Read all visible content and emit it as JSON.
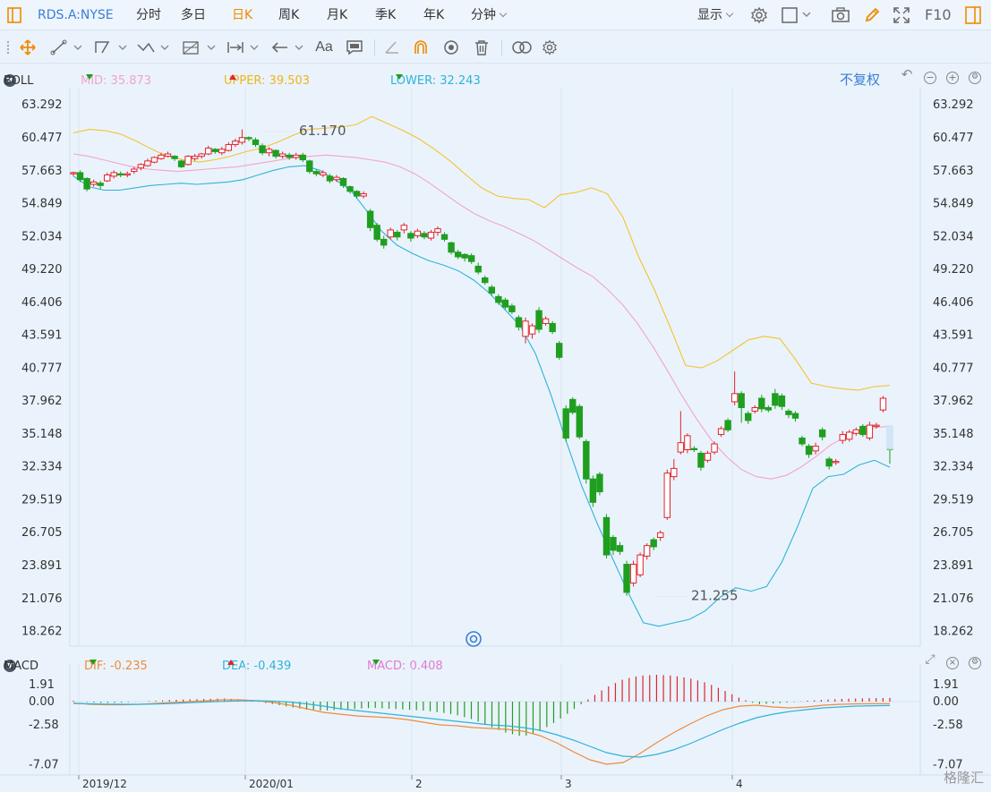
{
  "topbar": {
    "symbol": "RDS.A:NYSE",
    "periods": [
      "分时",
      "多日",
      "日K",
      "周K",
      "月K",
      "季K",
      "年K",
      "分钟"
    ],
    "active_period": "日K",
    "display_label": "显示",
    "f10_label": "F10"
  },
  "boll_legend": {
    "name": "BOLL",
    "mid": "MID: 35.873",
    "upper": "UPPER: 39.503",
    "lower": "LOWER: 32.243",
    "adjust_label": "不复权"
  },
  "macd_legend": {
    "name": "MACD",
    "dif": "DIF: -0.235",
    "dea": "DEA: -0.439",
    "macd": "MACD: 0.408"
  },
  "colors": {
    "up": "#e0232b",
    "down": "#1f9e1f",
    "mid": "#f4a3c8",
    "upper": "#f5c22f",
    "lower": "#2fb3d8",
    "dif": "#f08a3c",
    "dea": "#2fb3d8",
    "active": "#f08a00",
    "link": "#3b7fd4"
  },
  "watermark": "格隆汇",
  "chart_data": [
    {
      "type": "candlestick",
      "title": "",
      "y_ticks": [
        "63.292",
        "60.477",
        "57.663",
        "54.849",
        "52.034",
        "49.220",
        "46.406",
        "43.591",
        "40.777",
        "37.962",
        "35.148",
        "32.334",
        "29.519",
        "26.705",
        "23.891",
        "21.076",
        "18.262"
      ],
      "ylim": [
        17.0,
        64.0
      ],
      "x_ticks": [
        "2019/12",
        "2020/01",
        "2",
        "3",
        "4"
      ],
      "annotations": [
        "61.170",
        "21.255"
      ],
      "candles": [
        [
          57.4,
          57.5,
          57.2,
          57.6
        ],
        [
          57.5,
          56.9,
          56.7,
          57.7
        ],
        [
          57.0,
          56.1,
          55.9,
          57.1
        ],
        [
          56.5,
          56.7,
          56.3,
          56.9
        ],
        [
          56.6,
          56.4,
          56.1,
          56.8
        ],
        [
          56.8,
          57.3,
          56.7,
          57.5
        ],
        [
          57.2,
          57.5,
          57.0,
          57.7
        ],
        [
          57.4,
          57.3,
          57.1,
          57.6
        ],
        [
          57.3,
          57.4,
          57.1,
          57.6
        ],
        [
          57.6,
          57.8,
          57.4,
          58.0
        ],
        [
          57.9,
          58.2,
          57.7,
          58.3
        ],
        [
          58.1,
          58.5,
          58.0,
          58.7
        ],
        [
          58.4,
          58.8,
          58.3,
          58.9
        ],
        [
          58.7,
          59.0,
          58.6,
          59.2
        ],
        [
          58.9,
          59.1,
          58.8,
          59.3
        ],
        [
          58.9,
          58.7,
          58.5,
          59.0
        ],
        [
          58.5,
          58.0,
          57.9,
          58.6
        ],
        [
          58.2,
          58.9,
          58.1,
          59.0
        ],
        [
          58.7,
          58.9,
          58.5,
          59.1
        ],
        [
          58.9,
          59.1,
          58.7,
          59.2
        ],
        [
          59.1,
          59.6,
          59.0,
          59.8
        ],
        [
          59.5,
          59.3,
          59.1,
          59.6
        ],
        [
          59.2,
          59.5,
          59.0,
          59.7
        ],
        [
          59.4,
          59.9,
          59.3,
          60.1
        ],
        [
          59.9,
          60.2,
          59.7,
          60.4
        ],
        [
          60.1,
          60.5,
          59.9,
          61.2
        ],
        [
          60.5,
          60.4,
          60.2,
          60.6
        ],
        [
          60.3,
          59.9,
          59.7,
          60.5
        ],
        [
          59.8,
          59.2,
          59.0,
          60.0
        ],
        [
          59.2,
          59.5,
          58.9,
          59.7
        ],
        [
          59.4,
          58.9,
          58.7,
          59.5
        ],
        [
          58.9,
          59.1,
          58.7,
          59.3
        ],
        [
          59.0,
          58.8,
          58.6,
          59.2
        ],
        [
          58.8,
          59.0,
          58.6,
          59.2
        ],
        [
          59.0,
          58.6,
          58.4,
          59.2
        ],
        [
          58.5,
          57.6,
          57.4,
          58.6
        ],
        [
          57.6,
          57.4,
          57.2,
          57.8
        ],
        [
          57.3,
          57.5,
          57.1,
          57.7
        ],
        [
          57.2,
          56.8,
          56.6,
          57.4
        ],
        [
          56.9,
          57.1,
          56.7,
          57.3
        ],
        [
          57.0,
          56.4,
          56.2,
          57.1
        ],
        [
          56.3,
          55.9,
          55.7,
          56.4
        ],
        [
          55.9,
          55.5,
          55.3,
          56.0
        ],
        [
          55.5,
          55.7,
          55.3,
          55.9
        ],
        [
          54.2,
          52.8,
          52.5,
          54.4
        ],
        [
          53.0,
          51.8,
          51.6,
          53.2
        ],
        [
          51.8,
          51.3,
          51.0,
          52.1
        ],
        [
          52.0,
          52.6,
          51.8,
          52.8
        ],
        [
          52.4,
          52.0,
          51.7,
          52.6
        ],
        [
          52.6,
          53.0,
          52.3,
          53.2
        ],
        [
          52.3,
          51.9,
          51.6,
          52.5
        ],
        [
          52.1,
          52.5,
          51.9,
          52.7
        ],
        [
          52.3,
          52.0,
          51.8,
          52.5
        ],
        [
          51.9,
          52.4,
          51.7,
          52.6
        ],
        [
          52.4,
          52.7,
          52.1,
          52.9
        ],
        [
          52.2,
          51.8,
          51.6,
          52.4
        ],
        [
          51.5,
          50.7,
          50.5,
          51.6
        ],
        [
          50.7,
          50.3,
          50.1,
          50.9
        ],
        [
          50.5,
          50.2,
          49.9,
          50.6
        ],
        [
          50.4,
          49.9,
          49.7,
          50.6
        ],
        [
          49.5,
          49.0,
          48.8,
          49.8
        ],
        [
          48.5,
          48.1,
          47.9,
          48.7
        ],
        [
          47.7,
          47.2,
          47.0,
          47.9
        ],
        [
          46.9,
          46.4,
          46.2,
          47.1
        ],
        [
          46.6,
          46.0,
          45.8,
          46.8
        ],
        [
          46.1,
          45.6,
          45.4,
          46.3
        ],
        [
          45.1,
          44.3,
          44.0,
          45.3
        ],
        [
          43.5,
          44.8,
          42.9,
          45.1
        ],
        [
          43.7,
          44.4,
          43.3,
          44.6
        ],
        [
          45.7,
          44.1,
          43.8,
          46.0
        ],
        [
          44.6,
          45.0,
          44.4,
          45.2
        ],
        [
          44.6,
          43.9,
          43.7,
          44.8
        ],
        [
          42.9,
          41.7,
          41.5,
          43.1
        ],
        [
          37.3,
          34.8,
          34.5,
          37.6
        ],
        [
          38.1,
          37.0,
          36.8,
          38.3
        ],
        [
          37.5,
          34.9,
          34.7,
          37.7
        ],
        [
          34.5,
          31.3,
          30.9,
          34.7
        ],
        [
          31.3,
          29.3,
          28.9,
          31.6
        ],
        [
          31.7,
          30.2,
          29.9,
          31.9
        ],
        [
          28.0,
          24.8,
          24.5,
          28.3
        ],
        [
          26.3,
          25.2,
          24.8,
          26.5
        ],
        [
          25.6,
          25.1,
          24.8,
          25.9
        ],
        [
          24.0,
          21.6,
          21.3,
          24.3
        ],
        [
          22.4,
          24.0,
          22.1,
          24.3
        ],
        [
          23.1,
          24.8,
          22.9,
          25.0
        ],
        [
          24.7,
          25.6,
          24.4,
          25.8
        ],
        [
          26.1,
          25.5,
          25.2,
          26.3
        ],
        [
          26.3,
          26.7,
          26.0,
          26.9
        ],
        [
          28.0,
          31.8,
          27.8,
          32.1
        ],
        [
          31.5,
          32.2,
          31.2,
          33.0
        ],
        [
          33.6,
          34.4,
          33.4,
          37.1
        ],
        [
          33.8,
          35.0,
          33.5,
          35.2
        ],
        [
          33.9,
          33.8,
          33.6,
          34.1
        ],
        [
          33.5,
          32.3,
          32.0,
          33.7
        ],
        [
          32.9,
          33.5,
          32.7,
          33.7
        ],
        [
          33.6,
          34.3,
          33.4,
          34.5
        ],
        [
          35.1,
          35.6,
          34.9,
          35.8
        ],
        [
          36.3,
          35.5,
          35.3,
          36.5
        ],
        [
          37.9,
          38.6,
          37.6,
          40.5
        ],
        [
          38.6,
          37.4,
          36.1,
          38.8
        ],
        [
          36.9,
          36.3,
          36.0,
          37.1
        ],
        [
          37.1,
          37.4,
          36.9,
          37.6
        ],
        [
          38.2,
          37.3,
          37.0,
          38.5
        ],
        [
          37.4,
          37.2,
          37.0,
          37.6
        ],
        [
          38.6,
          37.6,
          37.3,
          39.0
        ],
        [
          38.4,
          37.5,
          37.2,
          38.6
        ],
        [
          37.1,
          36.8,
          36.5,
          37.3
        ],
        [
          36.9,
          36.5,
          36.2,
          37.1
        ],
        [
          34.8,
          34.3,
          34.1,
          35.0
        ],
        [
          34.1,
          33.4,
          33.1,
          34.3
        ],
        [
          33.7,
          34.1,
          33.4,
          34.4
        ],
        [
          35.5,
          34.9,
          34.6,
          35.7
        ],
        [
          33.0,
          32.4,
          32.1,
          33.2
        ],
        [
          32.7,
          32.8,
          32.5,
          33.0
        ],
        [
          34.6,
          35.1,
          34.3,
          35.4
        ],
        [
          34.7,
          35.3,
          34.5,
          35.5
        ],
        [
          35.2,
          35.5,
          35.0,
          35.7
        ],
        [
          35.8,
          35.1,
          34.9,
          36.0
        ],
        [
          34.8,
          35.9,
          34.6,
          36.2
        ],
        [
          35.8,
          35.9,
          35.6,
          36.1
        ],
        [
          37.2,
          38.2,
          37.0,
          38.4
        ],
        [
          33.9,
          33.8,
          32.6,
          34.0
        ]
      ],
      "mid": [
        59.1,
        58.9,
        58.6,
        58.3,
        58.0,
        57.8,
        57.7,
        57.6,
        57.7,
        57.8,
        57.9,
        58.0,
        58.2,
        58.4,
        58.6,
        58.8,
        58.9,
        59.0,
        58.9,
        58.8,
        58.6,
        58.4,
        58.0,
        57.4,
        56.6,
        55.7,
        54.8,
        54.0,
        53.4,
        52.9,
        52.3,
        51.7,
        50.9,
        50.1,
        49.3,
        48.6,
        47.5,
        46.2,
        44.6,
        42.7,
        40.6,
        38.4,
        36.4,
        34.6,
        33.2,
        32.1,
        31.5,
        31.3,
        31.6,
        32.3,
        33.2,
        34.2,
        34.9,
        35.4,
        35.7,
        35.8
      ],
      "upper": [
        60.9,
        61.2,
        61.1,
        60.8,
        60.2,
        59.5,
        58.9,
        58.6,
        58.4,
        58.6,
        58.9,
        59.3,
        59.6,
        60.1,
        60.7,
        61.2,
        61.3,
        61.4,
        61.6,
        62.3,
        61.7,
        61.1,
        60.4,
        59.5,
        58.5,
        57.3,
        56.2,
        55.5,
        55.3,
        55.2,
        54.5,
        55.6,
        55.8,
        56.2,
        55.7,
        53.7,
        50.3,
        47.5,
        44.3,
        41.0,
        40.8,
        41.4,
        42.3,
        43.2,
        43.5,
        43.3,
        41.5,
        39.5,
        39.2,
        39.0,
        38.9,
        39.2,
        39.3
      ],
      "lower": [
        57.2,
        56.3,
        56.0,
        56.0,
        56.2,
        56.4,
        56.5,
        56.6,
        56.5,
        56.6,
        56.7,
        56.9,
        57.3,
        57.7,
        58.0,
        58.1,
        57.7,
        56.9,
        56.0,
        54.3,
        52.5,
        51.3,
        50.6,
        50.0,
        49.6,
        49.1,
        48.3,
        47.2,
        45.8,
        44.4,
        42.0,
        38.5,
        34.5,
        30.7,
        27.5,
        24.5,
        21.6,
        19.0,
        18.7,
        19.0,
        19.3,
        20.0,
        21.2,
        22.0,
        21.7,
        22.1,
        24.2,
        27.2,
        30.5,
        31.5,
        31.7,
        32.5,
        32.9,
        32.3
      ]
    },
    {
      "type": "bar",
      "title": "",
      "y_ticks": [
        "1.91",
        "0.00",
        "-2.58",
        "-7.07"
      ],
      "ylim": [
        -7.4,
        3.2
      ],
      "series": [
        {
          "name": "DIF",
          "values": [
            -0.15,
            -0.3,
            -0.35,
            -0.35,
            -0.3,
            -0.2,
            -0.1,
            0.0,
            0.1,
            0.2,
            0.2,
            0.1,
            -0.1,
            -0.4,
            -0.8,
            -1.2,
            -1.4,
            -1.6,
            -1.7,
            -1.8,
            -2.0,
            -2.3,
            -2.6,
            -2.7,
            -2.9,
            -3.0,
            -3.1,
            -3.3,
            -3.8,
            -4.6,
            -5.6,
            -6.5,
            -7.0,
            -6.8,
            -5.8,
            -4.6,
            -3.5,
            -2.5,
            -1.6,
            -0.9,
            -0.5,
            -0.4,
            -0.6,
            -0.7,
            -0.6,
            -0.4,
            -0.3,
            -0.25,
            -0.24,
            -0.235
          ]
        },
        {
          "name": "DEA",
          "values": [
            -0.2,
            -0.25,
            -0.28,
            -0.3,
            -0.3,
            -0.26,
            -0.2,
            -0.12,
            -0.04,
            0.02,
            0.08,
            0.1,
            0.05,
            -0.05,
            -0.25,
            -0.5,
            -0.8,
            -1.0,
            -1.2,
            -1.4,
            -1.6,
            -1.8,
            -2.0,
            -2.2,
            -2.4,
            -2.6,
            -2.7,
            -2.9,
            -3.2,
            -3.7,
            -4.3,
            -5.0,
            -5.7,
            -6.1,
            -6.2,
            -5.9,
            -5.4,
            -4.7,
            -3.9,
            -3.1,
            -2.4,
            -1.8,
            -1.4,
            -1.1,
            -0.9,
            -0.7,
            -0.6,
            -0.5,
            -0.46,
            -0.439
          ]
        },
        {
          "name": "MACD",
          "values": [
            0.1,
            -0.1,
            -0.15,
            -0.1,
            0.0,
            0.1,
            0.2,
            0.25,
            0.3,
            0.35,
            0.25,
            0.0,
            -0.3,
            -0.6,
            -0.9,
            -1.0,
            -0.9,
            -0.8,
            -0.7,
            -0.8,
            -0.9,
            -1.0,
            -1.2,
            -1.5,
            -2.0,
            -2.8,
            -3.5,
            -3.9,
            -3.3,
            -2.2,
            -0.9,
            0.4,
            1.6,
            2.5,
            2.9,
            3.0,
            2.9,
            2.6,
            2.1,
            1.3,
            0.4,
            -0.3,
            -0.2,
            -0.1,
            0.1,
            0.2,
            0.3,
            0.35,
            0.4,
            0.408
          ]
        }
      ]
    }
  ]
}
